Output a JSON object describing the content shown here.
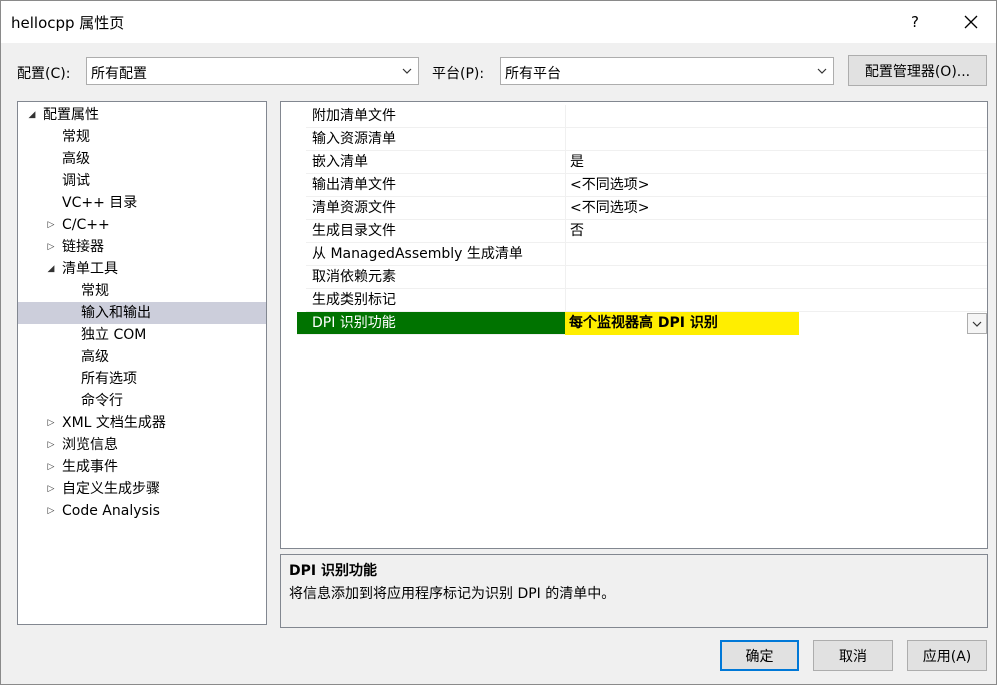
{
  "window": {
    "title": "hellocpp 属性页",
    "help_label": "?"
  },
  "toolbar": {
    "config_label": "配置(C):",
    "config_value": "所有配置",
    "platform_label": "平台(P):",
    "platform_value": "所有平台",
    "config_manager_label": "配置管理器(O)..."
  },
  "tree": {
    "items": [
      {
        "label": "配置属性",
        "expander": "◢"
      },
      {
        "label": "常规"
      },
      {
        "label": "高级"
      },
      {
        "label": "调试"
      },
      {
        "label": "VC++ 目录"
      },
      {
        "label": "C/C++",
        "expander": "▷"
      },
      {
        "label": "链接器",
        "expander": "▷"
      },
      {
        "label": "清单工具",
        "expander": "◢"
      },
      {
        "label": "常规"
      },
      {
        "label": "输入和输出"
      },
      {
        "label": "独立 COM"
      },
      {
        "label": "高级"
      },
      {
        "label": "所有选项"
      },
      {
        "label": "命令行"
      },
      {
        "label": "XML 文档生成器",
        "expander": "▷"
      },
      {
        "label": "浏览信息",
        "expander": "▷"
      },
      {
        "label": "生成事件",
        "expander": "▷"
      },
      {
        "label": "自定义生成步骤",
        "expander": "▷"
      },
      {
        "label": "Code Analysis",
        "expander": "▷"
      }
    ]
  },
  "grid": {
    "rows": [
      {
        "name": "附加清单文件",
        "value": ""
      },
      {
        "name": "输入资源清单",
        "value": ""
      },
      {
        "name": "嵌入清单",
        "value": "是"
      },
      {
        "name": "输出清单文件",
        "value": "<不同选项>"
      },
      {
        "name": "清单资源文件",
        "value": "<不同选项>"
      },
      {
        "name": "生成目录文件",
        "value": "否"
      },
      {
        "name": "从 ManagedAssembly 生成清单",
        "value": ""
      },
      {
        "name": "取消依赖元素",
        "value": ""
      },
      {
        "name": "生成类别标记",
        "value": ""
      },
      {
        "name": "DPI 识别功能",
        "value": "每个监视器高 DPI 识别"
      }
    ]
  },
  "description": {
    "title": "DPI 识别功能",
    "text": "将信息添加到将应用程序标记为识别 DPI 的清单中。"
  },
  "buttons": {
    "ok": "确定",
    "cancel": "取消",
    "apply": "应用(A)"
  },
  "colors": {
    "selected_name_bg": "#007300",
    "selected_value_bg": "#ffee00",
    "tree_selected_bg": "#cccedb",
    "accent": "#0078d7"
  }
}
